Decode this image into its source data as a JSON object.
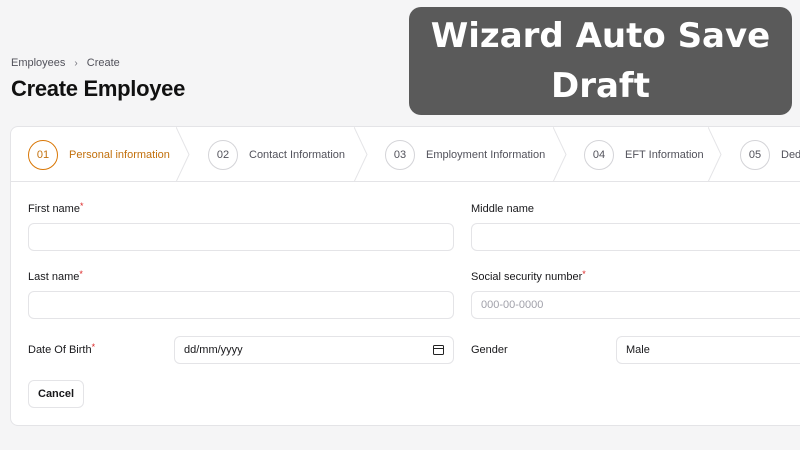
{
  "breadcrumb": {
    "items": [
      "Employees",
      "Create"
    ],
    "separator": "›"
  },
  "page": {
    "title": "Create Employee"
  },
  "overlay": {
    "text": "Wizard Auto Save Draft"
  },
  "steps": [
    {
      "number": "01",
      "label": "Personal information",
      "active": true
    },
    {
      "number": "02",
      "label": "Contact Information",
      "active": false
    },
    {
      "number": "03",
      "label": "Employment Information",
      "active": false
    },
    {
      "number": "04",
      "label": "EFT Information",
      "active": false
    },
    {
      "number": "05",
      "label": "Ded",
      "active": false
    }
  ],
  "form": {
    "first_name": {
      "label": "First name",
      "required": "*",
      "value": "",
      "placeholder": ""
    },
    "middle_name": {
      "label": "Middle name",
      "value": "",
      "placeholder": ""
    },
    "last_name": {
      "label": "Last name",
      "required": "*",
      "value": "",
      "placeholder": ""
    },
    "ssn": {
      "label": "Social security number",
      "required": "*",
      "value": "",
      "placeholder": "000-00-0000"
    },
    "dob": {
      "label": "Date Of Birth",
      "required": "*",
      "value": "dd/mm/yyyy"
    },
    "gender": {
      "label": "Gender",
      "value": "Male"
    },
    "cancel_label": "Cancel"
  },
  "colors": {
    "accent": "#d97706",
    "required": "#dc2626",
    "overlay_bg": "#5a5a5a"
  }
}
